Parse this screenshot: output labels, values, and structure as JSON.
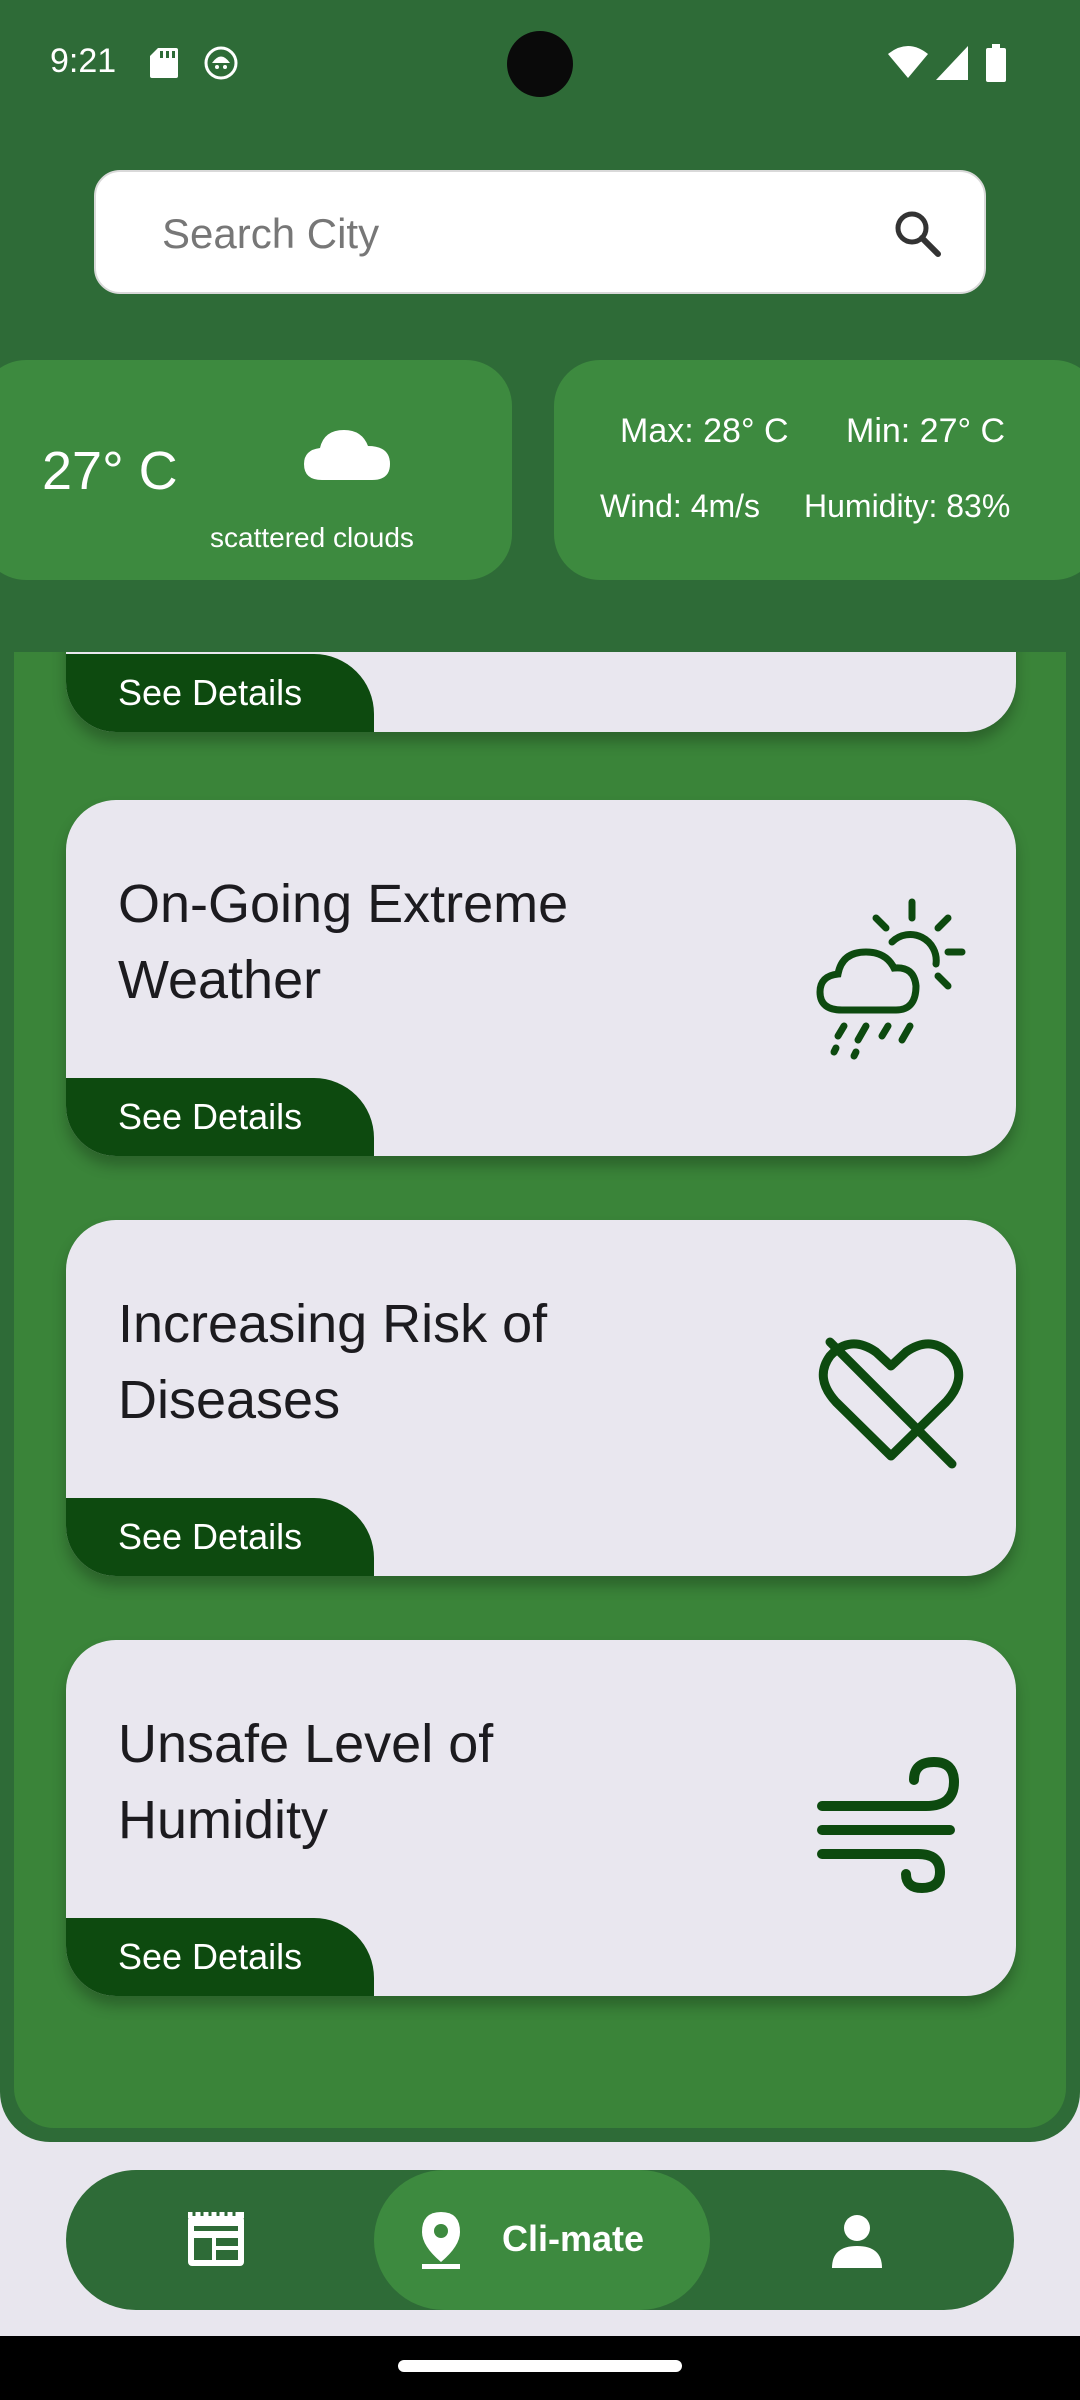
{
  "status_bar": {
    "time": "9:21"
  },
  "search": {
    "placeholder": "Search City"
  },
  "weather": {
    "temperature": "27° C",
    "condition": "scattered clouds",
    "max": "Max: 28° C",
    "min": "Min: 27° C",
    "wind": "Wind: 4m/s",
    "humidity": "Humidity: 83%"
  },
  "cards": [
    {
      "title": "",
      "button": "See Details",
      "icon": "none"
    },
    {
      "title": "On-Going Extreme Weather",
      "button": "See Details",
      "icon": "cloud-sun-rain-icon"
    },
    {
      "title": "Increasing Risk of Diseases",
      "button": "See Details",
      "icon": "heart-off-icon"
    },
    {
      "title": "Unsafe Level of Humidity",
      "button": "See Details",
      "icon": "wind-icon"
    }
  ],
  "bottom_nav": {
    "items": [
      {
        "icon": "newspaper-icon",
        "label": ""
      },
      {
        "icon": "location-pin-icon",
        "label": "Cli-mate",
        "selected": true
      },
      {
        "icon": "person-icon",
        "label": ""
      }
    ]
  },
  "colors": {
    "header_green": "#2e6b37",
    "card_green": "#3d8a3f",
    "panel_green": "#3a8439",
    "tab_dark_green": "#0d4a0f",
    "card_bg": "#e9e7ef",
    "icon_green": "#0d4a0f"
  }
}
